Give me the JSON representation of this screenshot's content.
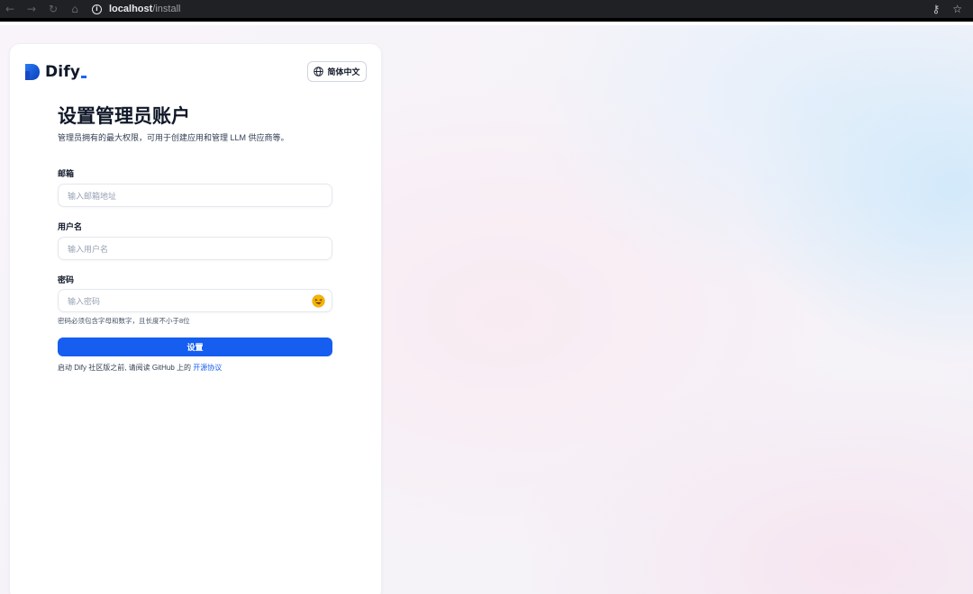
{
  "browser": {
    "url_host": "localhost",
    "url_path": "/install",
    "back_icon": "←",
    "forward_icon": "→",
    "reload_icon": "↻",
    "home_icon": "⌂",
    "info_icon": "i",
    "key_icon": "⚷",
    "star_icon": "☆"
  },
  "header": {
    "logo_text": "Dify",
    "language_label": "简体中文"
  },
  "form": {
    "title": "设置管理员账户",
    "subtitle": "管理员拥有的最大权限，可用于创建应用和管理 LLM 供应商等。",
    "email": {
      "label": "邮箱",
      "placeholder": "输入邮箱地址"
    },
    "username": {
      "label": "用户名",
      "placeholder": "输入用户名"
    },
    "password": {
      "label": "密码",
      "placeholder": "输入密码",
      "hint": "密码必须包含字母和数字，且长度不小于8位"
    },
    "submit_label": "设置",
    "agreement_prefix": "启动 Dify 社区版之前, 请阅读 GitHub 上的 ",
    "agreement_link": "开源协议"
  },
  "colors": {
    "primary": "#155eef",
    "text": "#101828",
    "brand_blue": "#1c64f2"
  }
}
